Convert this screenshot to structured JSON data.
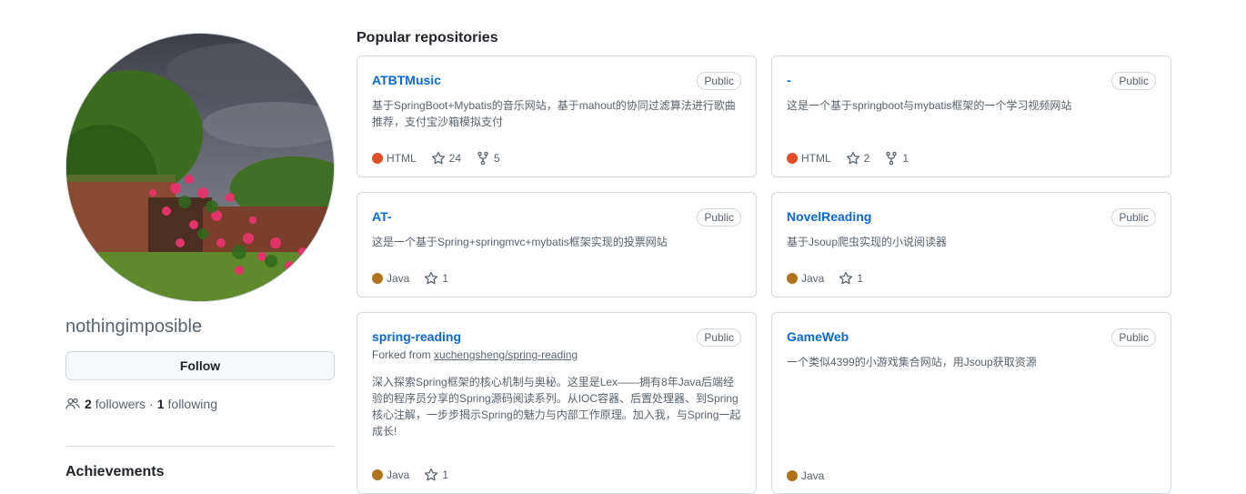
{
  "profile": {
    "username": "nothingimposible",
    "follow_label": "Follow",
    "followers_count": "2",
    "followers_label": "followers",
    "separator": "·",
    "following_count": "1",
    "following_label": "following",
    "achievements_title": "Achievements"
  },
  "section_title": "Popular repositories",
  "repos": [
    {
      "name": "ATBTMusic",
      "visibility": "Public",
      "description": "基于SpringBoot+Mybatis的音乐网站，基于mahout的协同过滤算法进行歌曲推荐，支付宝沙箱模拟支付",
      "language": "HTML",
      "lang_color": "#e34c26",
      "stars": "24",
      "forks": "5"
    },
    {
      "name": "-",
      "visibility": "Public",
      "description": "这是一个基于springboot与mybatis框架的一个学习视频网站",
      "language": "HTML",
      "lang_color": "#e34c26",
      "stars": "2",
      "forks": "1"
    },
    {
      "name": "AT-",
      "visibility": "Public",
      "description": "这是一个基于Spring+springmvc+mybatis框架实现的投票网站",
      "language": "Java",
      "lang_color": "#b07219",
      "stars": "1"
    },
    {
      "name": "NovelReading",
      "visibility": "Public",
      "description": "基于Jsoup爬虫实现的小说阅读器",
      "language": "Java",
      "lang_color": "#b07219",
      "stars": "1"
    },
    {
      "name": "spring-reading",
      "visibility": "Public",
      "fork_prefix": "Forked from",
      "fork_source": "xuchengsheng/spring-reading",
      "description": "深入探索Spring框架的核心机制与奥秘。这里是Lex——拥有8年Java后端经验的程序员分享的Spring源码阅读系列。从IOC容器、后置处理器、到Spring核心注解，一步步揭示Spring的魅力与内部工作原理。加入我，与Spring一起成长!",
      "language": "Java",
      "lang_color": "#b07219",
      "stars": "1"
    },
    {
      "name": "GameWeb",
      "visibility": "Public",
      "description": "一个类似4399的小游戏集合网站，用Jsoup获取资源",
      "language": "Java",
      "lang_color": "#b07219"
    }
  ]
}
